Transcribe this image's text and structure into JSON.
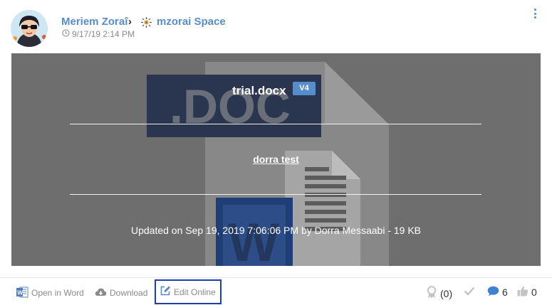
{
  "header": {
    "author": "Meriem Zoraî",
    "chevron": "›",
    "space": "mzorai Space",
    "date": "9/17/19 2:14 PM"
  },
  "preview": {
    "file_name": "trial.docx",
    "version": "V4",
    "description": "dorra test",
    "updated": "Updated on Sep 19, 2019 7:06:06 PM by Dorra Messaabi - 19 KB",
    "background_text": ".DOC"
  },
  "actions": {
    "open_in_word": "Open in Word",
    "download": "Download",
    "edit_online": "Edit Online"
  },
  "stats": {
    "kudos": "(0)",
    "comments": "6",
    "likes": "0"
  },
  "colors": {
    "accent": "#578dc9",
    "preview_bg": "#6e6e6e",
    "focus_outline": "#1f3ea8",
    "muted": "#8a8a8a"
  },
  "icons": {
    "avatar": "user-avatar",
    "space": "space-icon",
    "clock": "clock-icon",
    "menu": "kebab-menu-icon",
    "word": "word-icon",
    "download": "cloud-download-icon",
    "edit": "edit-icon",
    "kudos": "award-icon",
    "check": "check-icon",
    "comment": "comment-icon",
    "like": "thumbs-up-icon"
  }
}
